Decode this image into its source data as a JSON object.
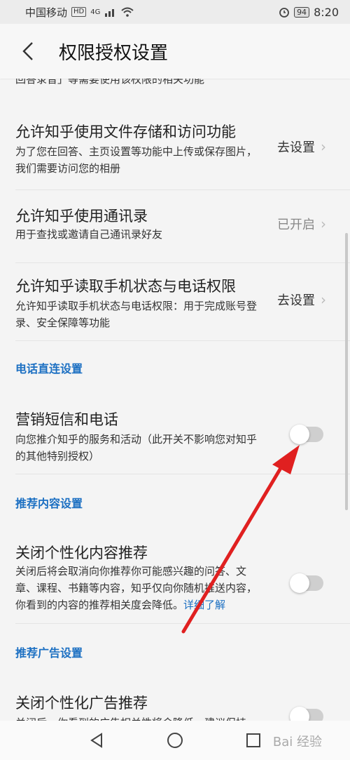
{
  "status": {
    "carrier": "中国移动",
    "hd": "HD",
    "signal": "4G",
    "battery": "94",
    "time": "8:20"
  },
  "header": {
    "title": "权限授权设置"
  },
  "partial_text": "回答录音」等需要使用该权限的相关功能",
  "items": [
    {
      "title": "允许知乎使用文件存储和访问功能",
      "desc": "为了您在回答、主页设置等功能中上传或保存图片，我们需要访问您的相册",
      "action": "去设置"
    },
    {
      "title": "允许知乎使用通讯录",
      "desc": "用于查找或邀请自己通讯录好友",
      "action": "已开启"
    },
    {
      "title": "允许知乎读取手机状态与电话权限",
      "desc": "允许知乎读取手机状态与电话权限：用于完成账号登录、安全保障等功能",
      "action": "去设置"
    }
  ],
  "sections": {
    "phone": "电话直连设置",
    "recommend": "推荐内容设置",
    "ads": "推荐广告设置"
  },
  "toggles": [
    {
      "title": "营销短信和电话",
      "desc": "向您推介知乎的服务和活动（此开关不影响您对知乎的其他特别授权）",
      "on": false
    },
    {
      "title": "关闭个性化内容推荐",
      "desc": "关闭后将会取消向你推荐你可能感兴趣的问答、文章、课程、书籍等内容，知乎仅向你随机推送内容，你看到的内容的推荐相关度会降低。",
      "link": "详细了解",
      "on": false
    },
    {
      "title": "关闭个性化广告推荐",
      "desc": "关闭后，你看到的广告相关性将会降低，建议保持",
      "on": false
    }
  ],
  "watermark": "Bai 经验",
  "colors": {
    "accent": "#1b6fc2",
    "arrow": "#e02020"
  }
}
